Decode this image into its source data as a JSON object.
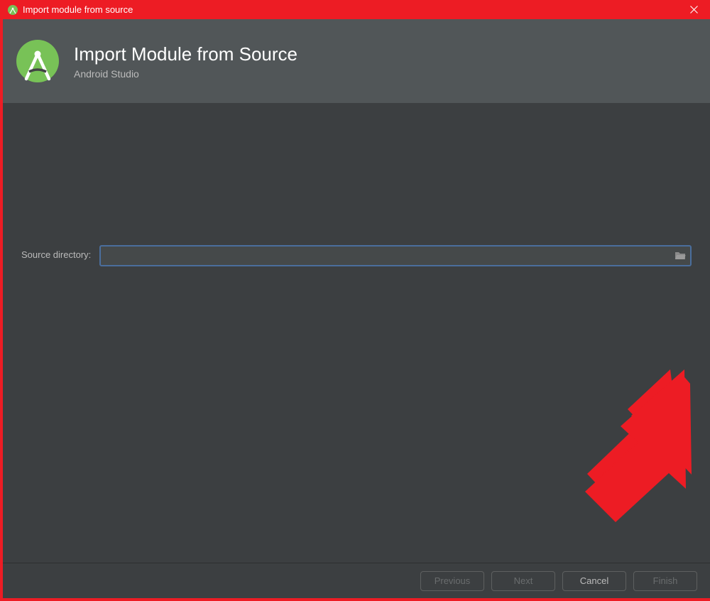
{
  "titlebar": {
    "title": "Import module from source"
  },
  "header": {
    "title": "Import Module from Source",
    "subtitle": "Android Studio"
  },
  "content": {
    "source_directory_label": "Source directory:",
    "source_directory_value": ""
  },
  "footer": {
    "previous_label": "Previous",
    "next_label": "Next",
    "cancel_label": "Cancel",
    "finish_label": "Finish"
  },
  "colors": {
    "accent_red": "#ed1c24",
    "panel_bg": "#3c3f41",
    "header_bg": "#515658",
    "input_border": "#4a6e9d",
    "logo_green": "#78c257"
  }
}
